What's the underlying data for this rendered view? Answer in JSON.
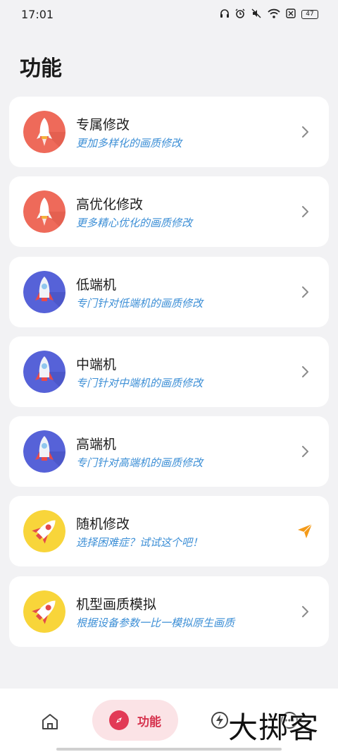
{
  "status_bar": {
    "time": "17:01",
    "icons": [
      "headphones-icon",
      "alarm-icon",
      "mute-icon",
      "wifi-icon",
      "sim-icon",
      "battery-icon"
    ],
    "battery_level": "47"
  },
  "page": {
    "title": "功能"
  },
  "cards": [
    {
      "title": "专属修改",
      "subtitle": "更加多样化的画质修改",
      "icon": "rocket-red-icon",
      "action_icon": "chevron-right-icon"
    },
    {
      "title": "高优化修改",
      "subtitle": "更多精心优化的画质修改",
      "icon": "rocket-red-icon",
      "action_icon": "chevron-right-icon"
    },
    {
      "title": "低端机",
      "subtitle": "专门针对低端机的画质修改",
      "icon": "rocket-blue-icon",
      "action_icon": "chevron-right-icon"
    },
    {
      "title": "中端机",
      "subtitle": "专门针对中端机的画质修改",
      "icon": "rocket-blue-icon",
      "action_icon": "chevron-right-icon"
    },
    {
      "title": "高端机",
      "subtitle": "专门针对高端机的画质修改",
      "icon": "rocket-blue-icon",
      "action_icon": "chevron-right-icon"
    },
    {
      "title": "随机修改",
      "subtitle": "选择困难症？试试这个吧！",
      "icon": "rocket-yellow-icon",
      "action_icon": "send-icon"
    },
    {
      "title": "机型画质模拟",
      "subtitle": "根据设备参数一比一模拟原生画质",
      "icon": "rocket-yellow-icon",
      "action_icon": "chevron-right-icon"
    }
  ],
  "bottom_nav": {
    "items": [
      {
        "name": "home",
        "icon": "home-icon"
      },
      {
        "name": "features",
        "icon": "compass-icon",
        "label": "功能",
        "active": true
      },
      {
        "name": "boost",
        "icon": "lightning-icon"
      },
      {
        "name": "more",
        "icon": "more-icon"
      }
    ]
  },
  "watermark": "大掷客",
  "colors": {
    "background": "#f2f2f4",
    "card": "#ffffff",
    "subtitle": "#3d8fd6",
    "nav_active_bg": "#fbe3e6",
    "nav_active_fg": "#d6334e",
    "rocket_red_bg": "#ee6a5a",
    "rocket_blue_bg": "#5662d8",
    "rocket_yellow_bg": "#f8d53a"
  }
}
